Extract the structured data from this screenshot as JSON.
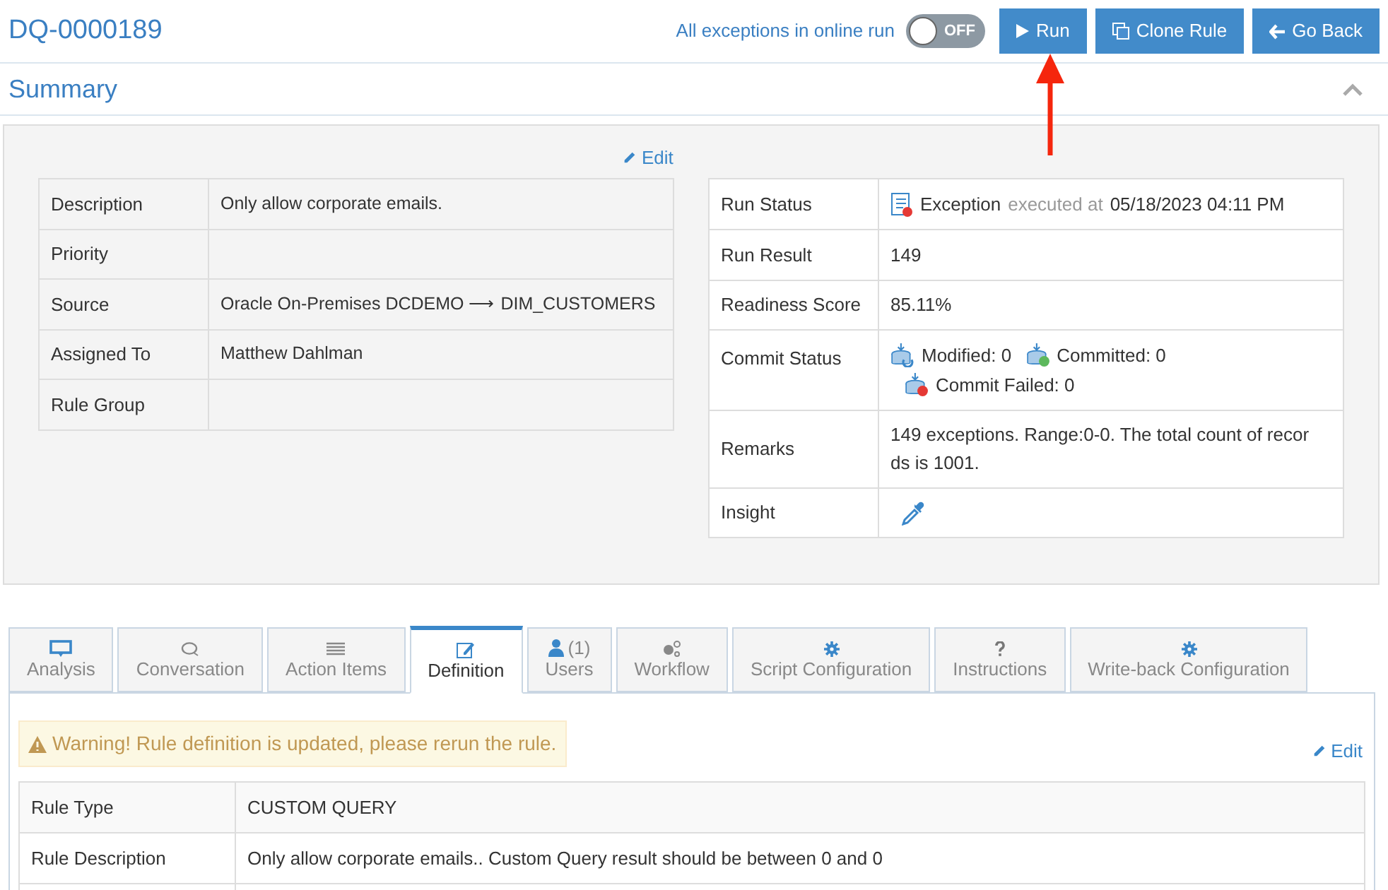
{
  "header": {
    "title": "DQ-0000189",
    "toggle_label": "All exceptions in online run",
    "toggle": {
      "on": false,
      "text": "OFF"
    },
    "buttons": [
      {
        "kind": "run",
        "label": "Run"
      },
      {
        "kind": "clone",
        "label": "Clone Rule"
      },
      {
        "kind": "back",
        "label": "Go Back"
      }
    ]
  },
  "summary": {
    "title": "Summary",
    "expanded": true,
    "edit": "Edit",
    "left_rows": [
      {
        "label": "Description",
        "value": "Only allow corporate emails."
      },
      {
        "label": "Priority",
        "value": ""
      },
      {
        "label": "Source",
        "value": "Oracle On-Premises DCDEMO ⟶ DIM_CUSTOMERS"
      },
      {
        "label": "Assigned To",
        "value": "Matthew Dahlman"
      },
      {
        "label": "Rule Group",
        "value": ""
      }
    ],
    "run_status": {
      "label": "Run Status",
      "status": "Exception",
      "executed_at_label": "executed at",
      "time": "05/18/2023 04:11 PM"
    },
    "run_result": {
      "label": "Run Result",
      "value": "149"
    },
    "readiness": {
      "label": "Readiness Score",
      "value": "85.11%"
    },
    "commit_status": {
      "label": "Commit Status",
      "items": [
        {
          "kind": "modified",
          "text": "Modified: 0"
        },
        {
          "kind": "committed",
          "text": "Committed: 0"
        },
        {
          "kind": "failed",
          "text": "Commit Failed: 0"
        }
      ]
    },
    "remarks": {
      "label": "Remarks",
      "value": "149 exceptions. Range:0-0. The total count of recor ds is 1001."
    },
    "insight": {
      "label": "Insight"
    }
  },
  "tabs": [
    {
      "kind": "analysis",
      "label": "Analysis",
      "selected": false
    },
    {
      "kind": "conversation",
      "label": "Conversation",
      "selected": false
    },
    {
      "kind": "list",
      "label": "Action Items",
      "selected": false
    },
    {
      "kind": "edit",
      "label": "Definition",
      "selected": true
    },
    {
      "kind": "users",
      "count": "(1)",
      "label": "Users",
      "selected": false
    },
    {
      "kind": "workflow",
      "label": "Workflow",
      "selected": false
    },
    {
      "kind": "gear",
      "label": "Script Configuration",
      "selected": false
    },
    {
      "kind": "question",
      "label": "Instructions",
      "selected": false
    },
    {
      "kind": "gear",
      "label": "Write-back Configuration",
      "selected": false
    }
  ],
  "definition": {
    "warning": "Warning! Rule definition is updated, please rerun the rule.",
    "edit": "Edit",
    "rows": [
      {
        "label": "Rule Type",
        "value": "CUSTOM QUERY"
      },
      {
        "label": "Rule Description",
        "value": "Only allow corporate emails.. Custom Query result should be between 0 and 0"
      }
    ]
  }
}
